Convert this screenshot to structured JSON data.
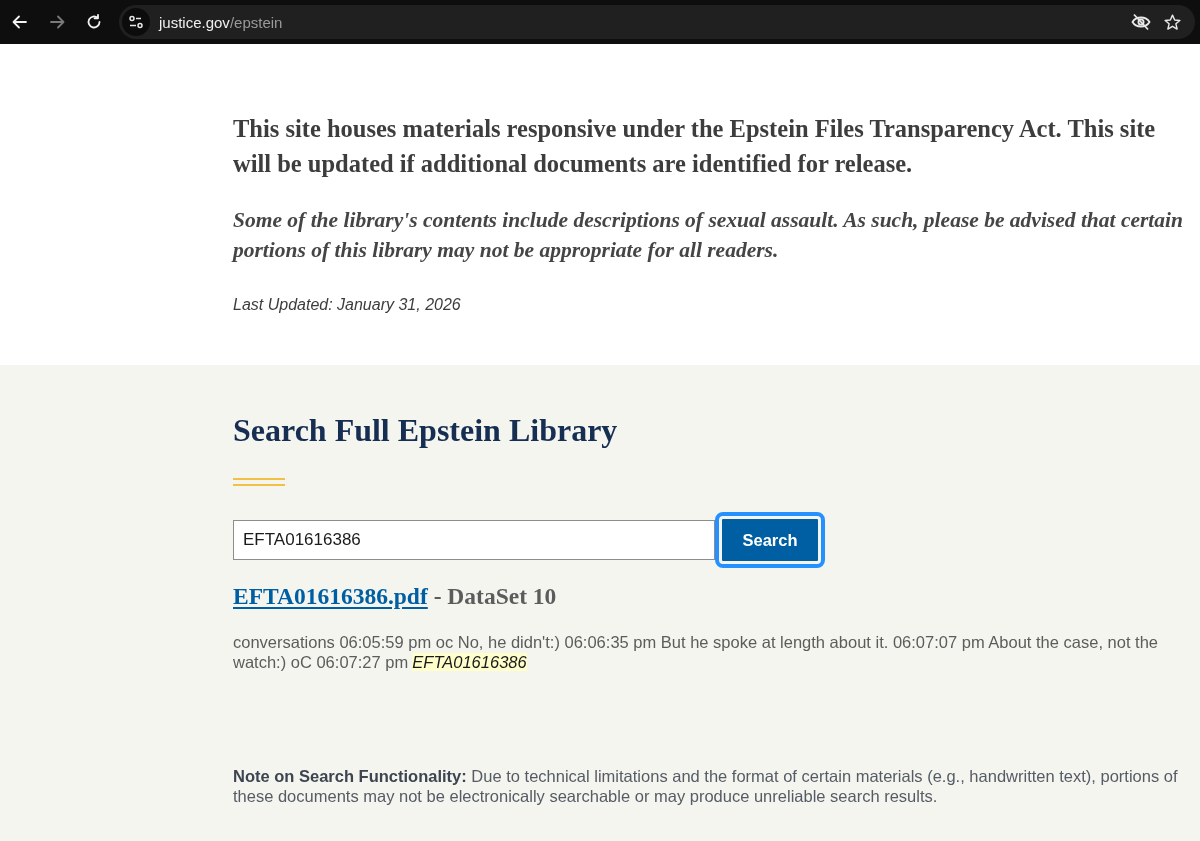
{
  "browser": {
    "back_disabled": false,
    "forward_disabled": true,
    "url_host": "justice.gov",
    "url_path": "/epstein"
  },
  "intro": {
    "statement": "This site houses materials responsive under the Epstein Files Transparency Act. This site will be updated if additional documents are identified for release.",
    "advisory": "Some of the library's contents include descriptions of sexual assault. As such, please be advised that certain portions of this library may not be appropriate for all readers.",
    "last_updated": "Last Updated: January 31, 2026"
  },
  "search": {
    "title": "Search Full Epstein Library",
    "query": "EFTA01616386",
    "button": {
      "label": "Search",
      "focused": true
    },
    "results": [
      {
        "file": "EFTA01616386.pdf",
        "dataset": "- DataSet 10",
        "snippet": [
          {
            "text": "conversations 06:05:59 pm oc No, he didn't:) 06:06:35 pm But he spoke at length about it. 06:07:07 pm About the case, not the watch:) oC 06:07:27 pm",
            "highlighted": false
          },
          {
            "text": "EFTA01616386",
            "highlighted": true
          }
        ]
      }
    ],
    "note": "**Note on Search Functionality:** Due to technical limitations and the format of certain materials (e.g., handwritten text), portions of these documents may not be electronically searchable or may produce unreliable search results."
  }
}
